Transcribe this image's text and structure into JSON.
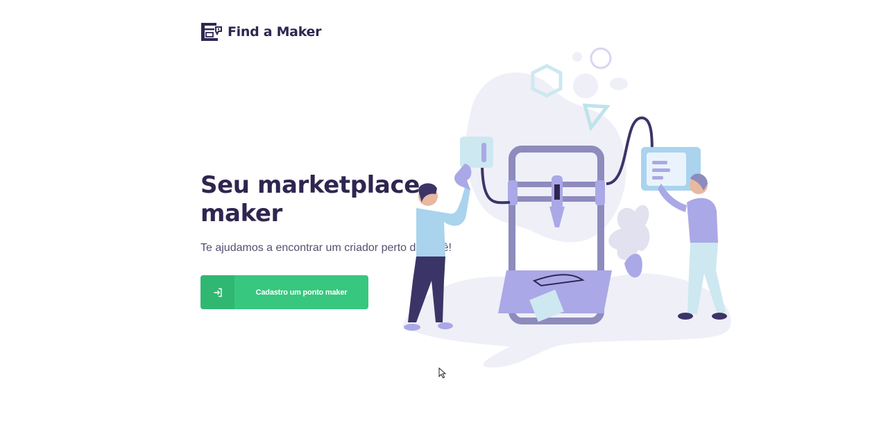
{
  "header": {
    "brand": "Find a Maker",
    "logo_icon": "printer-logo-icon"
  },
  "hero": {
    "title_line1": "Seu marketplace",
    "title_line2": "maker",
    "subtitle": "Te ajudamos a encontrar um criador perto de você!"
  },
  "cta": {
    "label": "Cadastro um ponto maker",
    "icon": "sign-in-icon"
  },
  "colors": {
    "brand_dark": "#2f2650",
    "accent_green": "#37c77f",
    "accent_green_dark": "#30b872",
    "illustration_purple": "#aaa8e6",
    "illustration_light": "#efeff8"
  }
}
